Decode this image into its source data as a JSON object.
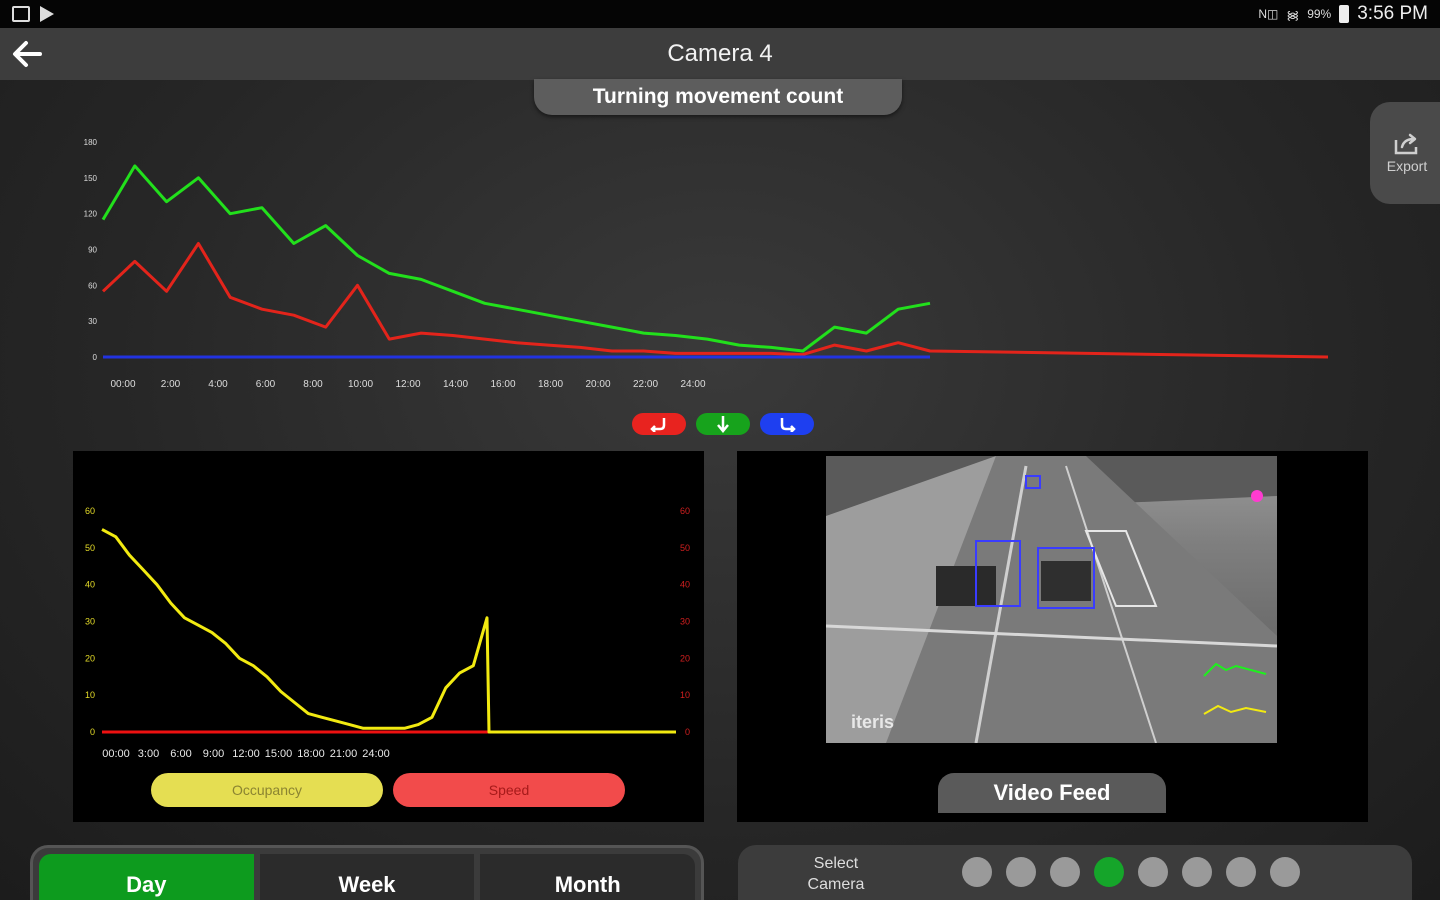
{
  "status_bar": {
    "time": "3:56 PM",
    "battery": "99%",
    "nfc": "N◫"
  },
  "header": {
    "title": "Camera 4"
  },
  "tmc": {
    "tab_label": "Turning movement count"
  },
  "export": {
    "label": "Export"
  },
  "chart_data": [
    {
      "type": "line",
      "title": "",
      "x": [
        "00:00",
        "2:00",
        "4:00",
        "6:00",
        "8:00",
        "10:00",
        "12:00",
        "14:00",
        "16:00",
        "18:00",
        "20:00",
        "22:00",
        "24:00"
      ],
      "ylim": [
        0,
        180
      ],
      "yticks": [
        0,
        30,
        60,
        90,
        120,
        150,
        180
      ],
      "grid": false,
      "series": [
        {
          "color": "#22e01c",
          "values": [
            115,
            160,
            130,
            150,
            120,
            125,
            95,
            110,
            85,
            70,
            65,
            55,
            45,
            40,
            35,
            30,
            25,
            20,
            18,
            15,
            10,
            8,
            5,
            25,
            20,
            40,
            45,
            0,
            0,
            0,
            0,
            0,
            0,
            0,
            0,
            0,
            0,
            0
          ]
        },
        {
          "color": "#e3241b",
          "values": [
            55,
            80,
            55,
            95,
            50,
            40,
            35,
            25,
            60,
            15,
            20,
            18,
            15,
            12,
            10,
            8,
            5,
            5,
            3,
            3,
            3,
            3,
            2,
            10,
            5,
            12,
            5,
            0,
            0,
            0,
            0,
            0,
            0,
            0,
            0,
            0,
            0,
            0
          ]
        },
        {
          "color": "#2233e0",
          "values": [
            0,
            0,
            0,
            0,
            0,
            0,
            0,
            0,
            0,
            0,
            0,
            0,
            0,
            0,
            0,
            0,
            0,
            0,
            0,
            0,
            0,
            0,
            0,
            0,
            0,
            0,
            0,
            0,
            0,
            0,
            0,
            0,
            0,
            0,
            0,
            0,
            0,
            0
          ]
        }
      ]
    },
    {
      "type": "line",
      "x": [
        "00:00",
        "3:00",
        "6:00",
        "9:00",
        "12:00",
        "15:00",
        "18:00",
        "21:00",
        "24:00"
      ],
      "ylim": [
        0,
        60
      ],
      "yticks_left": [
        0,
        10,
        20,
        30,
        40,
        50,
        60
      ],
      "yticks_right": [
        0,
        10,
        20,
        30,
        40,
        50,
        60
      ],
      "grid": false,
      "series": [
        {
          "name": "Occupancy",
          "color": "#f2ea11",
          "values": [
            55,
            53,
            48,
            44,
            40,
            35,
            31,
            29,
            27,
            24,
            20,
            18,
            15,
            11,
            8,
            5,
            4,
            3,
            2,
            1,
            1,
            1,
            1,
            2,
            4,
            12,
            16,
            18,
            31,
            0,
            0,
            0,
            0,
            0,
            0,
            0,
            0,
            0,
            0,
            0,
            0,
            0,
            0
          ]
        },
        {
          "name": "Speed",
          "color": "#e11",
          "values": [
            0,
            0,
            0,
            0,
            0,
            0,
            0,
            0,
            0,
            0,
            0,
            0,
            0,
            0,
            0,
            0,
            0,
            0,
            0,
            0,
            0,
            0,
            0,
            0,
            0,
            0,
            0,
            0,
            0,
            0,
            0,
            0,
            0,
            0,
            0,
            0,
            0,
            0,
            0,
            0,
            0,
            0,
            0
          ]
        }
      ]
    }
  ],
  "occupancy_pills": {
    "occupancy": "Occupancy",
    "speed": "Speed"
  },
  "video": {
    "tab_label": "Video Feed",
    "watermark": "iteris"
  },
  "period": {
    "day": "Day",
    "week": "Week",
    "month": "Month"
  },
  "camera_select": {
    "label_line1": "Select",
    "label_line2": "Camera",
    "cameras": [
      {
        "id": 1,
        "active": false
      },
      {
        "id": 2,
        "active": false
      },
      {
        "id": 3,
        "active": false
      },
      {
        "id": 4,
        "active": true
      },
      {
        "id": 5,
        "active": false
      },
      {
        "id": 6,
        "active": false
      },
      {
        "id": 7,
        "active": false
      },
      {
        "id": 8,
        "active": false
      }
    ]
  }
}
